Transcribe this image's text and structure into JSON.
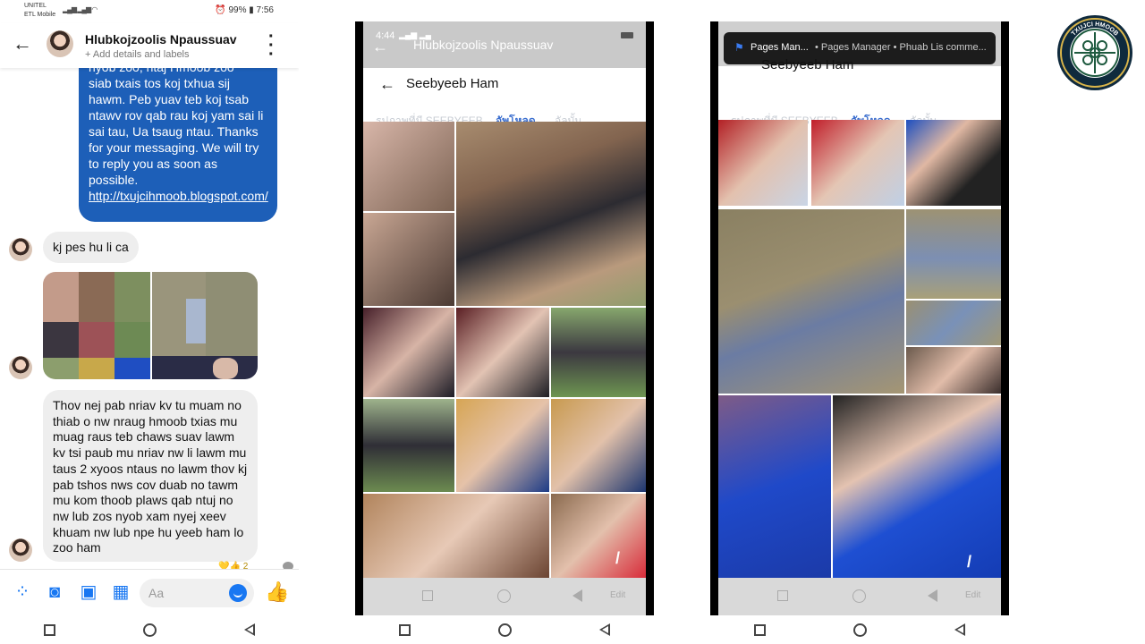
{
  "left": {
    "status": {
      "carrier": "UNITEL",
      "carrier2": "ETL Mobile",
      "battery": "99%",
      "time": "7:56"
    },
    "header": {
      "name": "Hlubkojzoolis Npaussuav",
      "sub": "+ Add details and labels"
    },
    "auto_reply": {
      "line_top": "nyob zoo, ntaj Hmoob zoo",
      "body": "siab txais tos koj txhua sij hawm. Peb yuav teb koj tsab ntawv rov qab rau koj yam sai li sai tau, Ua tsaug ntau. Thanks for your messaging. We will try to reply you as soon as possible.",
      "link": "http://txujcihmoob.blogspot.com/"
    },
    "msg1": "kj pes hu li ca",
    "msg2": "Thov nej pab nriav kv tu muam no thiab o nw nraug hmoob txias mu muag raus teb chaws suav lawm kv tsi paub mu nriav nw li lawm mu taus 2 xyoos ntaus no lawm thov kj pab tshos nws cov duab no tawm mu kom thoob plaws qab ntuj no nw lub zos nyob xam nyej xeev khuam nw lub npe hu yeeb ham lo zoo ham",
    "reaction_count": "2",
    "compose_placeholder": "Aa"
  },
  "phone1": {
    "status_time": "4:44",
    "ghost_title": "Hlubkojzoolis Npaussuav",
    "title": "Seebyeeb Ham",
    "tabs": [
      "รูปภาพที่มี SEEBYEEB",
      "อัพโหลด",
      "อัลบั้ม"
    ],
    "edit": "Edit"
  },
  "phone2": {
    "notif_icon": "pages-manager-flag-icon",
    "notif_app": "Pages Man...",
    "notif_text": "• Pages Manager • Phuab Lis comme...",
    "title": "Seebyeeb Ham",
    "tabs": [
      "รูปภาพที่มี SEEBYEEB",
      "อัพโหลด",
      "อัลบั้ม"
    ],
    "edit": "Edit"
  },
  "logo": {
    "text": "TXUJCI HMOOB"
  },
  "colors": {
    "messenger_blue": "#1877f2",
    "bubble_blue": "#1d5fb8",
    "tab_blue": "#3a6ecf"
  }
}
